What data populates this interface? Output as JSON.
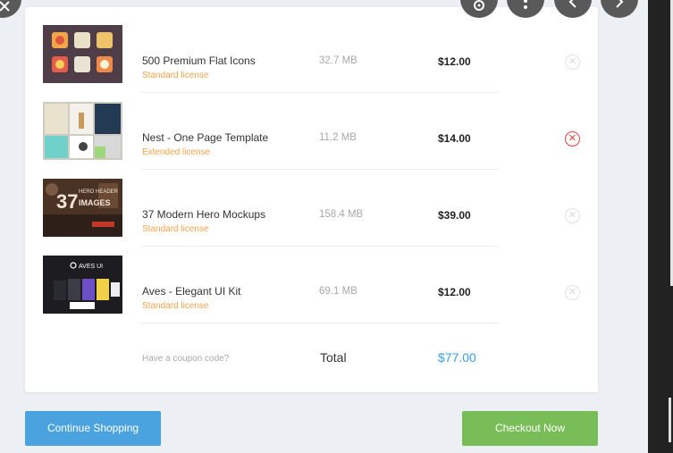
{
  "items": [
    {
      "name": "500 Premium Flat Icons",
      "license": "Standard license",
      "size": "32.7 MB",
      "price": "$12.00",
      "thumb": "flat-icons"
    },
    {
      "name": "Nest - One Page Template",
      "license": "Extended license",
      "size": "11.2 MB",
      "price": "$14.00",
      "thumb": "web-template"
    },
    {
      "name": "37 Modern Hero Mockups",
      "license": "Standard license",
      "size": "158.4 MB",
      "price": "$39.00",
      "thumb": "hero-mockups"
    },
    {
      "name": "Aves - Elegant UI Kit",
      "license": "Standard license",
      "size": "69.1 MB",
      "price": "$12.00",
      "thumb": "ui-kit"
    }
  ],
  "thumb_text": {
    "mockups": "37",
    "mockups_sub": "HERO HEADER",
    "mockups_sub2": "IMAGES",
    "ui_kit": "AVES UI"
  },
  "cart": {
    "coupon_prompt": "Have a coupon code?",
    "total_label": "Total",
    "total_value": "$77.00"
  },
  "actions": {
    "continue_label": "Continue Shopping",
    "checkout_label": "Checkout Now"
  },
  "colors": {
    "license": "#f3a24a",
    "total": "#3a9de0",
    "continue_button": "#4aa3df",
    "checkout_button": "#78bd57",
    "remove_active": "#e64040"
  },
  "viewer_controls": [
    "close-icon",
    "lens-icon",
    "more-options-icon",
    "previous-icon",
    "next-icon"
  ]
}
